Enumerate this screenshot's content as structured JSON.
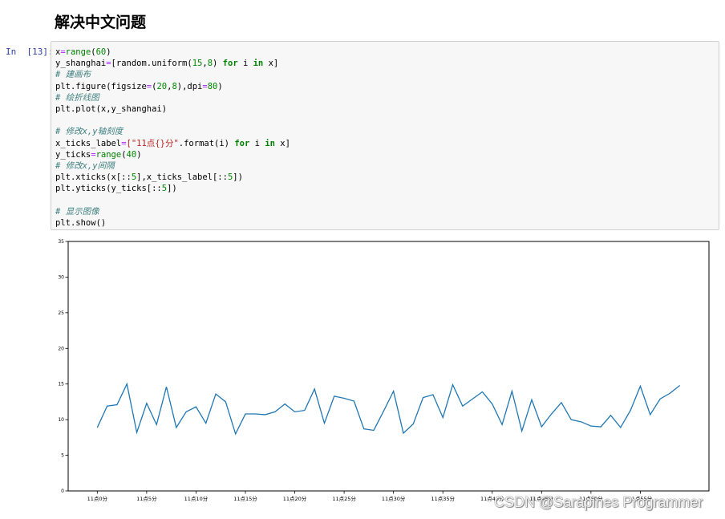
{
  "heading": "解决中文问题",
  "cell": {
    "prompt": "In  [13]:",
    "code": [
      [
        {
          "t": "x"
        },
        {
          "t": "=",
          "c": "op"
        },
        {
          "t": "range",
          "c": "bi"
        },
        {
          "t": "("
        },
        {
          "t": "60",
          "c": "num"
        },
        {
          "t": ")"
        }
      ],
      [
        {
          "t": "y_shanghai"
        },
        {
          "t": "=",
          "c": "op"
        },
        {
          "t": "[random.uniform("
        },
        {
          "t": "15",
          "c": "num"
        },
        {
          "t": ","
        },
        {
          "t": "8",
          "c": "num"
        },
        {
          "t": ") "
        },
        {
          "t": "for",
          "c": "kw"
        },
        {
          "t": " i "
        },
        {
          "t": "in",
          "c": "kw"
        },
        {
          "t": " x]"
        }
      ],
      [
        {
          "t": "# 建画布",
          "c": "cm"
        }
      ],
      [
        {
          "t": "plt.figure(figsize"
        },
        {
          "t": "=",
          "c": "op"
        },
        {
          "t": "("
        },
        {
          "t": "20",
          "c": "num"
        },
        {
          "t": ","
        },
        {
          "t": "8",
          "c": "num"
        },
        {
          "t": "),dpi"
        },
        {
          "t": "=",
          "c": "op"
        },
        {
          "t": "80",
          "c": "num"
        },
        {
          "t": ")"
        }
      ],
      [
        {
          "t": "# 绘折线图",
          "c": "cm"
        }
      ],
      [
        {
          "t": "plt.plot(x,y_shanghai)"
        }
      ],
      [],
      [
        {
          "t": "# 修改x,y轴刻度",
          "c": "cm"
        }
      ],
      [
        {
          "t": "x_ticks_label"
        },
        {
          "t": "=",
          "c": "op"
        },
        {
          "t": "[\"11点{}分\"",
          "c": "str"
        },
        {
          "t": ".format(i) "
        },
        {
          "t": "for",
          "c": "kw"
        },
        {
          "t": " i "
        },
        {
          "t": "in",
          "c": "kw"
        },
        {
          "t": " x]"
        }
      ],
      [
        {
          "t": "y_ticks"
        },
        {
          "t": "=",
          "c": "op"
        },
        {
          "t": "range",
          "c": "bi"
        },
        {
          "t": "("
        },
        {
          "t": "40",
          "c": "num"
        },
        {
          "t": ")"
        }
      ],
      [
        {
          "t": "# 修改x,y间隔",
          "c": "cm"
        }
      ],
      [
        {
          "t": "plt.xticks(x[::"
        },
        {
          "t": "5",
          "c": "num"
        },
        {
          "t": "],x_ticks_label[::"
        },
        {
          "t": "5",
          "c": "num"
        },
        {
          "t": "])"
        }
      ],
      [
        {
          "t": "plt.yticks(y_ticks[::"
        },
        {
          "t": "5",
          "c": "num"
        },
        {
          "t": "])"
        }
      ],
      [],
      [
        {
          "t": "# 显示图像",
          "c": "cm"
        }
      ],
      [
        {
          "t": "plt.show()"
        }
      ]
    ]
  },
  "chart_data": {
    "type": "line",
    "x": [
      0,
      1,
      2,
      3,
      4,
      5,
      6,
      7,
      8,
      9,
      10,
      11,
      12,
      13,
      14,
      15,
      16,
      17,
      18,
      19,
      20,
      21,
      22,
      23,
      24,
      25,
      26,
      27,
      28,
      29,
      30,
      31,
      32,
      33,
      34,
      35,
      36,
      37,
      38,
      39,
      40,
      41,
      42,
      43,
      44,
      45,
      46,
      47,
      48,
      49,
      50,
      51,
      52,
      53,
      54,
      55,
      56,
      57,
      58,
      59
    ],
    "series": [
      {
        "color": "#1f77b4",
        "values": [
          8.9,
          11.9,
          12.1,
          15.0,
          8.2,
          12.3,
          9.3,
          14.6,
          8.9,
          11.1,
          11.8,
          9.5,
          13.6,
          12.5,
          8.0,
          10.8,
          10.8,
          10.7,
          11.1,
          12.2,
          11.1,
          11.3,
          14.3,
          9.5,
          13.3,
          13.0,
          12.6,
          8.7,
          8.5,
          11.2,
          14.0,
          8.1,
          9.4,
          13.1,
          13.5,
          10.3,
          14.9,
          11.9,
          12.9,
          13.9,
          12.2,
          9.3,
          14.0,
          8.4,
          12.8,
          9.0,
          10.8,
          12.4,
          10.0,
          9.7,
          9.1,
          9.0,
          10.6,
          8.9,
          11.3,
          14.7,
          10.7,
          12.9,
          13.7,
          14.8
        ]
      }
    ],
    "x_ticks": [
      0,
      5,
      10,
      15,
      20,
      25,
      30,
      35,
      40,
      45,
      50,
      55
    ],
    "x_tick_labels": [
      "11点0分",
      "11点5分",
      "11点10分",
      "11点15分",
      "11点20分",
      "11点25分",
      "11点30分",
      "11点35分",
      "11点40分",
      "11点45分",
      "11点50分",
      "11点55分"
    ],
    "y_ticks": [
      0,
      5,
      10,
      15,
      20,
      25,
      30,
      35
    ],
    "y_tick_labels": [
      "0",
      "5",
      "10",
      "15",
      "20",
      "25",
      "30",
      "35"
    ],
    "xlim": [
      -2.95,
      61.95
    ],
    "ylim": [
      0,
      35
    ],
    "grid": false,
    "title": "",
    "xlabel": "",
    "ylabel": ""
  },
  "watermark": "CSDN @Sarapines Programmer"
}
